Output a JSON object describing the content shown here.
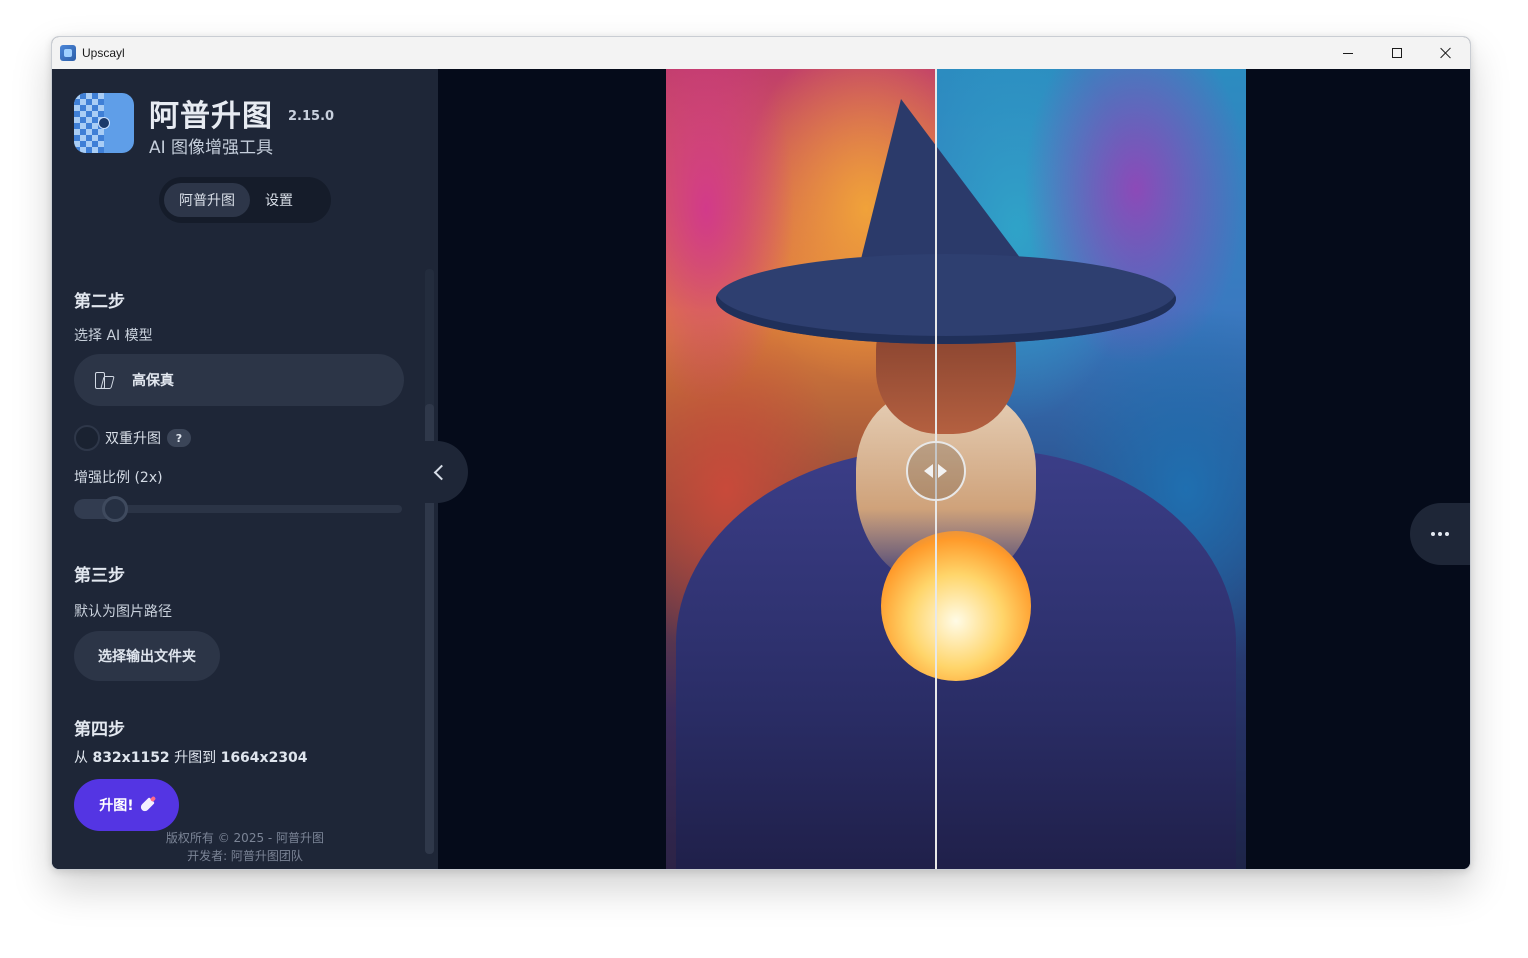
{
  "window": {
    "title": "Upscayl",
    "controls": [
      "minimize",
      "maximize",
      "close"
    ]
  },
  "header": {
    "app_name": "阿普升图",
    "version": "2.15.0",
    "tagline": "AI 图像增强工具"
  },
  "tabs": [
    {
      "label": "阿普升图",
      "active": true
    },
    {
      "label": "设置",
      "active": false
    }
  ],
  "step2": {
    "title": "第二步",
    "subtitle": "选择 AI 模型",
    "model_label": "高保真",
    "model_icon": "model-swap-icon",
    "double_upscale_label": "双重升图",
    "double_upscale_checked": false,
    "help_label": "?",
    "scale_label": "增强比例 (2x)",
    "scale_value": 2
  },
  "step3": {
    "title": "第三步",
    "subtitle": "默认为图片路径",
    "folder_button": "选择输出文件夹"
  },
  "step4": {
    "title": "第四步",
    "from_prefix": "从",
    "from_size": "832x1152",
    "mid_text": "升图到",
    "to_size": "1664x2304",
    "button_label": "升图!"
  },
  "footer": {
    "copyright": "版权所有 © 2025 - 阿普升图",
    "developer": "开发者: 阿普升图团队"
  },
  "viewer": {
    "comparison_position": 0.465,
    "collapse_icon": "chevron-left-icon",
    "more_icon": "more-horizontal-icon"
  }
}
